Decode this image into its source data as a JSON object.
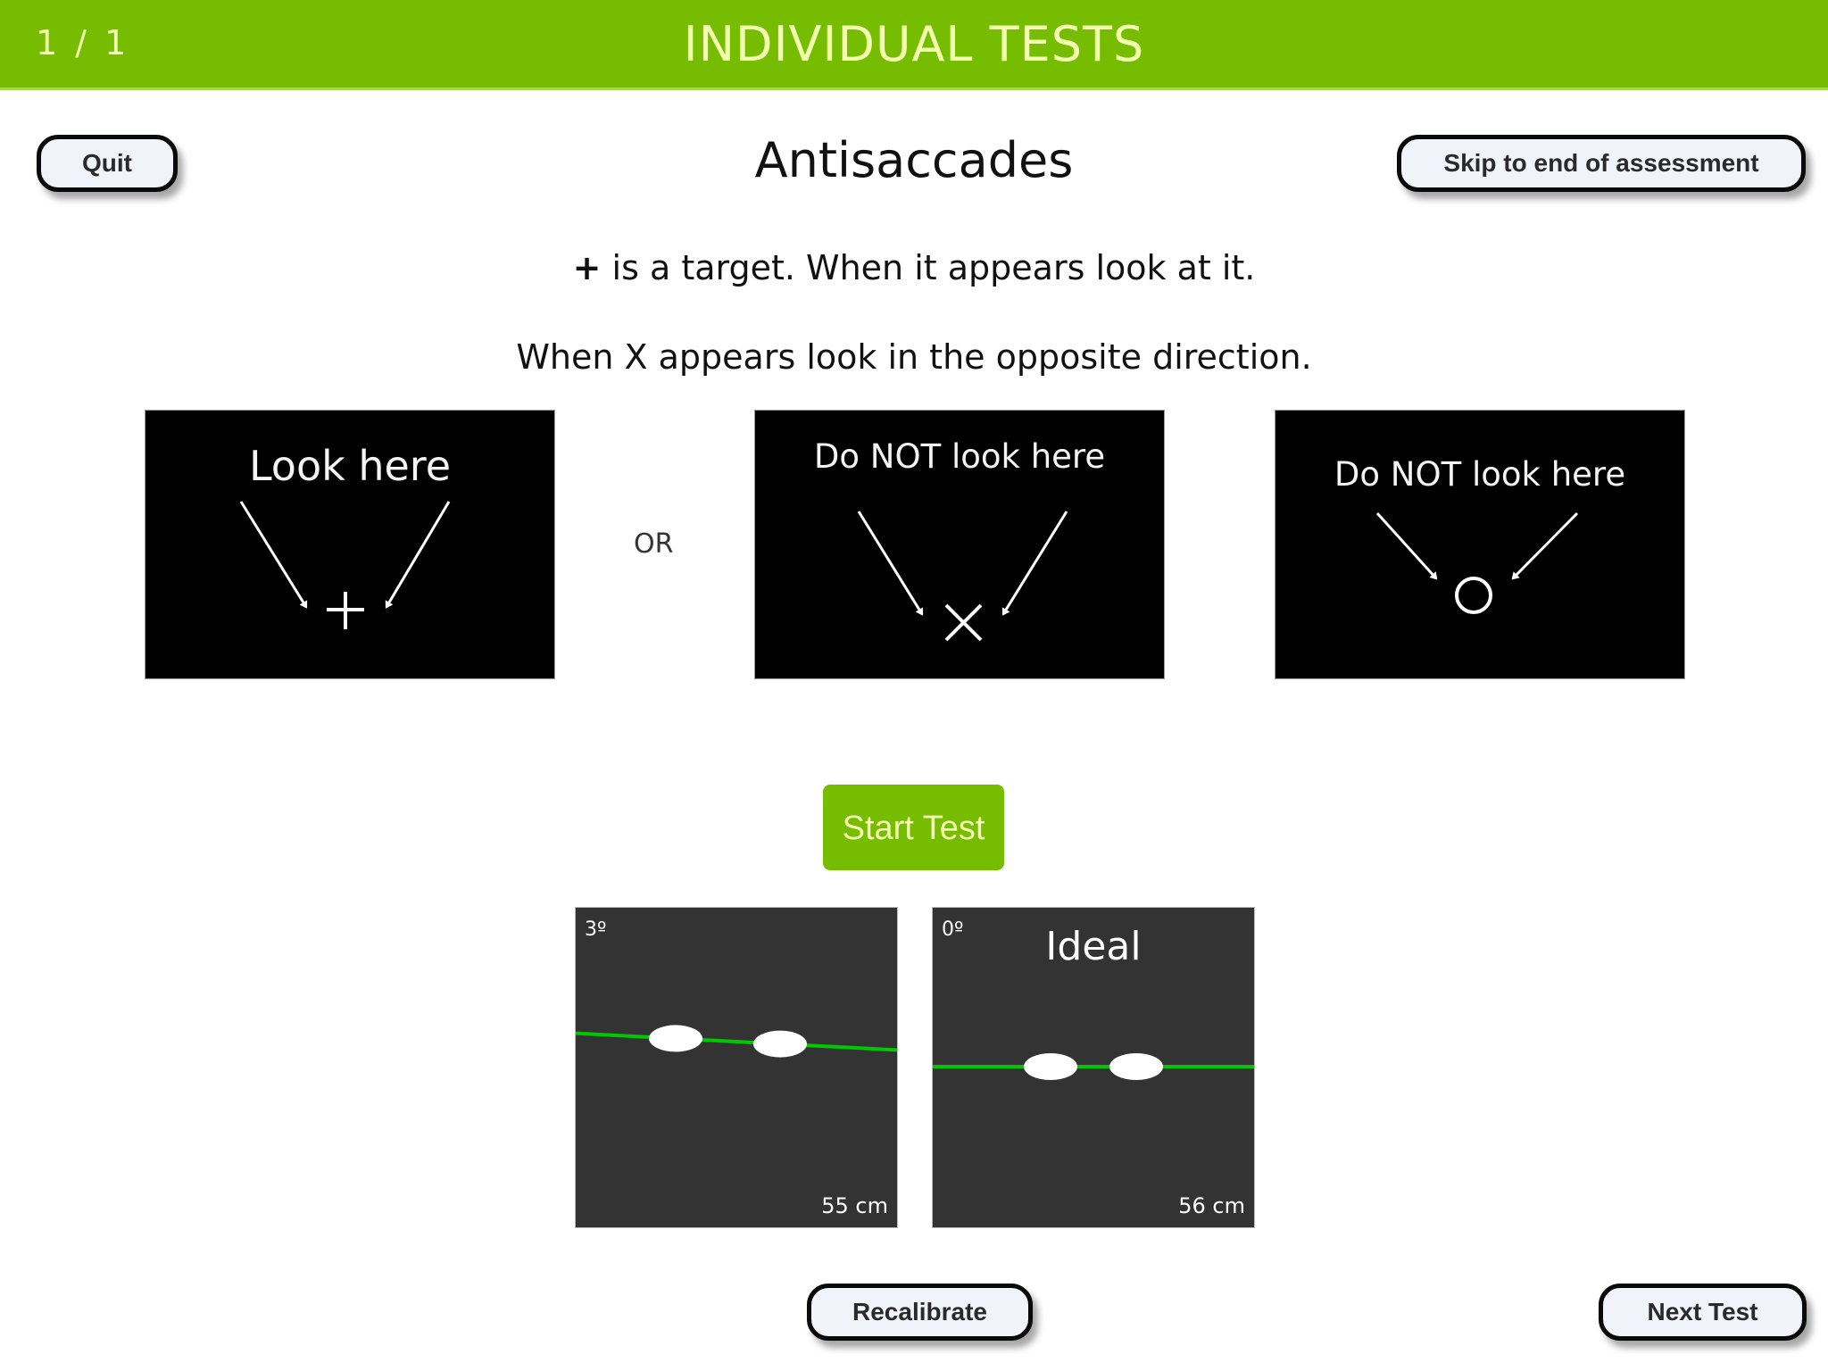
{
  "header": {
    "counter": "1 / 1",
    "title": "INDIVIDUAL TESTS"
  },
  "colors": {
    "brand_green": "#76bc00",
    "header_text": "#f2ffb0",
    "guide_line": "#00c800",
    "camera_bg": "#333333"
  },
  "toolbar": {
    "quit_label": "Quit",
    "skip_label": "Skip to end of assessment"
  },
  "test": {
    "title": "Antisaccades",
    "instruction_symbol": "+",
    "instruction_1": " is a target. When it appears look at it.",
    "instruction_2": "When X appears look in the opposite direction."
  },
  "examples": {
    "or_label": "OR",
    "panels": [
      {
        "label": "Look here",
        "symbol": "plus-icon"
      },
      {
        "label": "Do NOT look here",
        "symbol": "x-icon"
      },
      {
        "label": "Do NOT look here",
        "symbol": "circle-icon"
      }
    ]
  },
  "start_label": "Start Test",
  "cameras": [
    {
      "angle": "3º",
      "distance": "55 cm",
      "status": "",
      "tilt_deg": 3
    },
    {
      "angle": "0º",
      "distance": "56 cm",
      "status": "Ideal",
      "tilt_deg": 0
    }
  ],
  "footer": {
    "recalibrate_label": "Recalibrate",
    "next_label": "Next Test"
  }
}
